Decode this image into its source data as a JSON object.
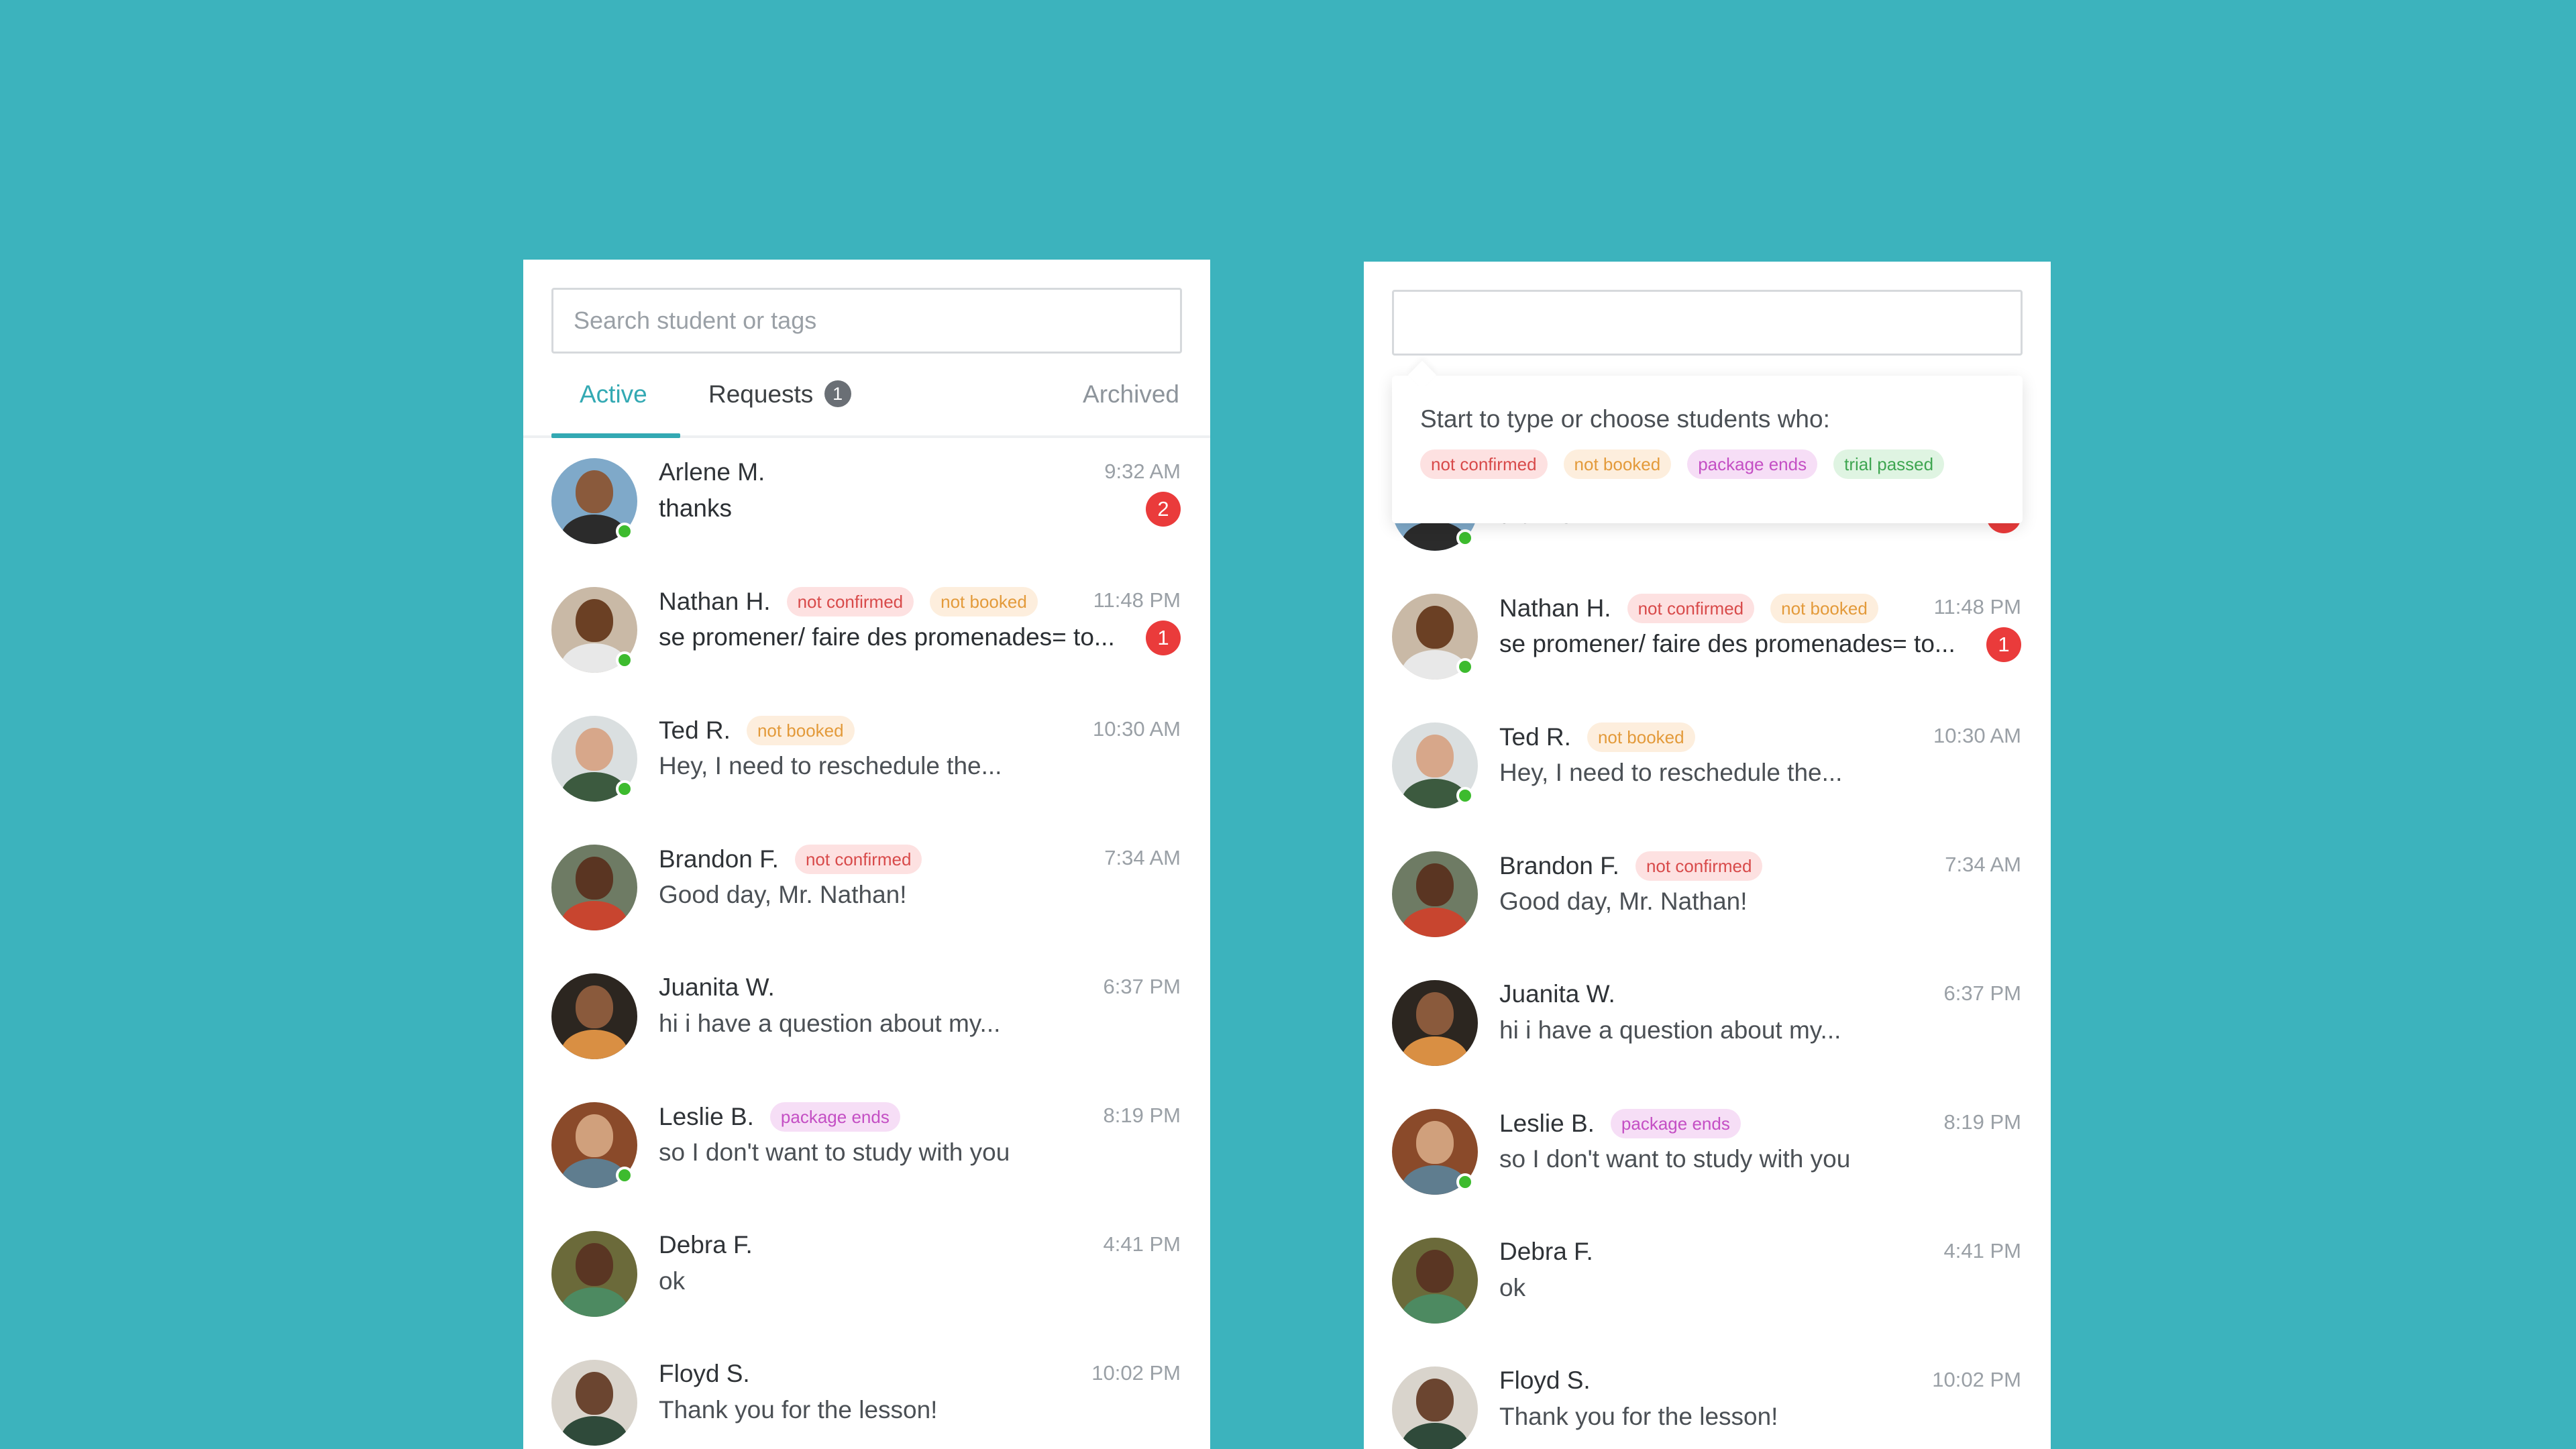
{
  "colors": {
    "background": "#3cb3bd",
    "accent": "#33a9b3",
    "online": "#3dbb2e",
    "unread_badge": "#ea3b3b"
  },
  "left_panel": {
    "search": {
      "placeholder": "Search student or tags"
    },
    "tabs": {
      "active": "Active",
      "requests": "Requests",
      "requests_count": "1",
      "archived": "Archived"
    }
  },
  "right_panel": {
    "search": {
      "value": ""
    },
    "dropdown": {
      "title": "Start to type or choose students who:",
      "tags": [
        "not confirmed",
        "not booked",
        "package ends",
        "trial passed"
      ]
    }
  },
  "conversations": [
    {
      "name": "Arlene M.",
      "tags": [],
      "message": "thanks",
      "time": "9:32 AM",
      "unread": "2",
      "online": true
    },
    {
      "name": "Nathan H.",
      "tags": [
        "not confirmed",
        "not booked"
      ],
      "message": "se promener/ faire des promenades= to...",
      "time": "11:48 PM",
      "unread": "1",
      "online": true
    },
    {
      "name": "Ted R.",
      "tags": [
        "not booked"
      ],
      "message": "Hey, I need to reschedule the...",
      "time": "10:30 AM",
      "unread": "",
      "online": true
    },
    {
      "name": "Brandon F.",
      "tags": [
        "not confirmed"
      ],
      "message": "Good day, Mr. Nathan!",
      "time": "7:34 AM",
      "unread": "",
      "online": false
    },
    {
      "name": "Juanita W.",
      "tags": [],
      "message": "hi i have a question about my...",
      "time": "6:37 PM",
      "unread": "",
      "online": false
    },
    {
      "name": "Leslie B.",
      "tags": [
        "package ends"
      ],
      "message": "so I don't want to study with you",
      "time": "8:19 PM",
      "unread": "",
      "online": true
    },
    {
      "name": "Debra F.",
      "tags": [],
      "message": "ok",
      "time": "4:41 PM",
      "unread": "",
      "online": false
    },
    {
      "name": "Floyd S.",
      "tags": [],
      "message": "Thank you for the lesson!",
      "time": "10:02 PM",
      "unread": "",
      "online": false
    }
  ]
}
